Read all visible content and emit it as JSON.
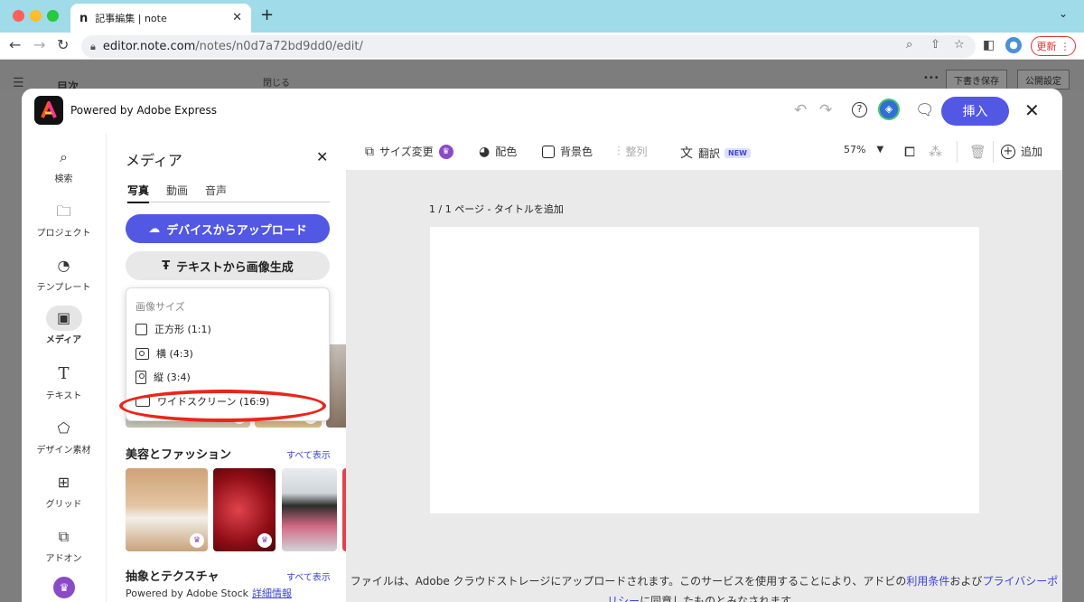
{
  "browser": {
    "tab_title": "記事編集 | note",
    "tab_favicon": "n",
    "url_host": "editor.note.com",
    "url_path": "/notes/n0d7a72bd9dd0/edit/",
    "update_label": "更新",
    "traffic_colors": [
      "#fe5f57",
      "#febc2e",
      "#28c840"
    ]
  },
  "note_page": {
    "sidebar_label": "目次",
    "close_label": "閉じる",
    "more": "•••",
    "save_draft": "下書き保存",
    "publish_settings": "公開設定"
  },
  "modal": {
    "title": "Powered by Adobe Express",
    "insert_label": "挿入",
    "rail": [
      {
        "label": "検索",
        "icon": "search-icon"
      },
      {
        "label": "プロジェクト",
        "icon": "folder-icon"
      },
      {
        "label": "テンプレート",
        "icon": "template-icon"
      },
      {
        "label": "メディア",
        "icon": "media-icon"
      },
      {
        "label": "テキスト",
        "icon": "text-icon"
      },
      {
        "label": "デザイン素材",
        "icon": "shapes-icon"
      },
      {
        "label": "グリッド",
        "icon": "grid-icon"
      },
      {
        "label": "アドオン",
        "icon": "addon-icon"
      }
    ]
  },
  "panel": {
    "title": "メディア",
    "tabs": [
      "写真",
      "動画",
      "音声"
    ],
    "upload_label": "デバイスからアップロード",
    "generate_label": "テキストから画像生成",
    "dropdown": {
      "heading": "画像サイズ",
      "items": [
        "正方形 (1:1)",
        "横 (4:3)",
        "縦 (3:4)",
        "ワイドスクリーン (16:9)"
      ]
    },
    "section1": {
      "title": "美容とファッション",
      "see_all": "すべて表示"
    },
    "section2": {
      "title": "抽象とテクスチャ",
      "see_all": "すべて表示"
    },
    "stock_text": "Powered by Adobe Stock",
    "stock_link": "詳細情報"
  },
  "canvas": {
    "toolbar": {
      "resize": "サイズ変更",
      "color": "配色",
      "background": "背景色",
      "align": "整列",
      "translate": "翻訳",
      "new_badge": "NEW",
      "zoom": "57%",
      "add": "追加"
    },
    "page_label": "1 / 1 ページ - タイトルを追加",
    "footer_text": "ファイルは、Adobe クラウドストレージにアップロードされます。このサービスを使用することにより、アドビの",
    "terms_link": "利用条件",
    "footer_and": "および",
    "privacy_link": "プライバシーポリシー",
    "footer_end": "に同意したものとみなされます。"
  }
}
